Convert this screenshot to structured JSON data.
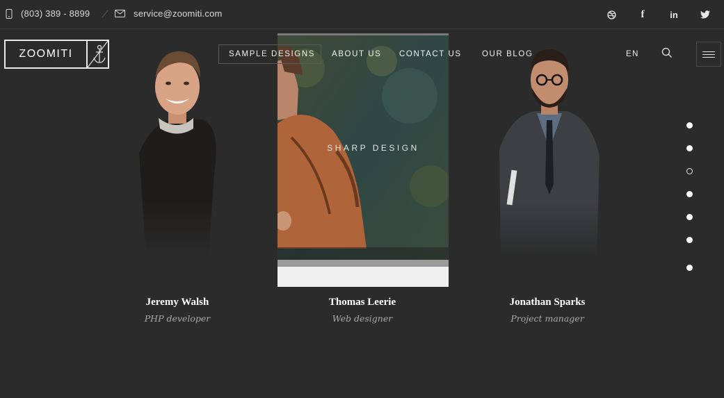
{
  "topbar": {
    "phone": "(803) 389 - 8899",
    "email": "service@zoomiti.com",
    "social": [
      "dribbble-icon",
      "facebook-icon",
      "linkedin-icon",
      "twitter-icon"
    ]
  },
  "header": {
    "logo_text": "ZOOMITI",
    "nav": [
      "SAMPLE DESIGNS",
      "ABOUT US",
      "CONTACT US",
      "OUR BLOG"
    ],
    "active_nav": "SAMPLE DESIGNS",
    "language": "EN"
  },
  "team": [
    {
      "name": "Jeremy Walsh",
      "role": "PHP developer"
    },
    {
      "name": "Thomas Leerie",
      "role": "Web designer",
      "overlay": "SHARP DESIGN"
    },
    {
      "name": "Jonathan Sparks",
      "role": "Project manager"
    }
  ],
  "pager": {
    "count": 7,
    "active_index": 2
  },
  "colors": {
    "background": "#2b2b2b",
    "text": "#ffffff",
    "muted": "#a9a9a9",
    "jacket": "#b0643a"
  }
}
